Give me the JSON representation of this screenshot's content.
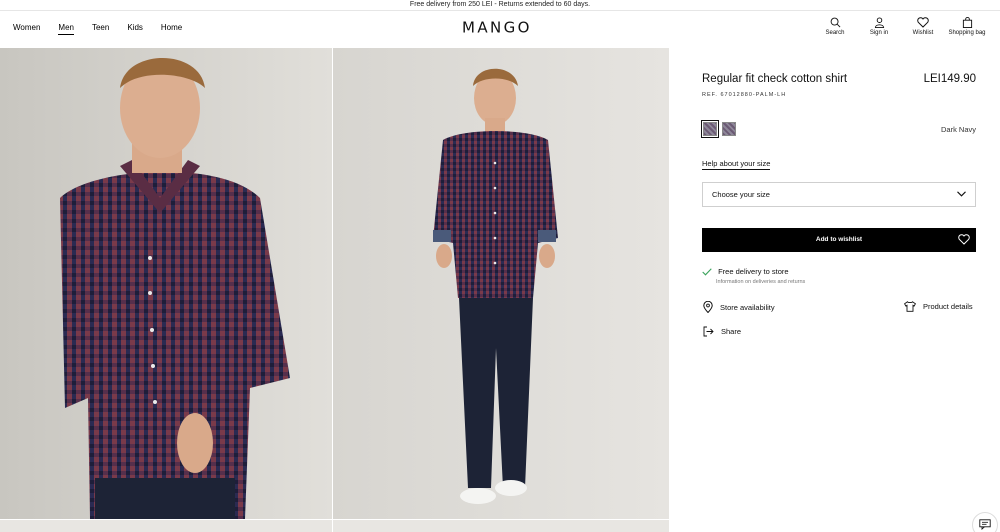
{
  "promo": "Free delivery from 250 LEI - Returns extended to 60 days.",
  "nav": [
    {
      "label": "Women",
      "active": false
    },
    {
      "label": "Men",
      "active": true
    },
    {
      "label": "Teen",
      "active": false
    },
    {
      "label": "Kids",
      "active": false
    },
    {
      "label": "Home",
      "active": false
    }
  ],
  "logo": "MANGO",
  "tools": {
    "search": "Search",
    "signin": "Sign in",
    "wishlist": "Wishlist",
    "bag": "Shopping bag"
  },
  "product": {
    "title": "Regular fit check cotton shirt",
    "price": "LEI149.90",
    "ref": "REF. 67012880-PALM-LH",
    "color_name": "Dark Navy",
    "help_size": "Help about your size",
    "size_placeholder": "Choose your size",
    "wishlist_button": "Add to wishlist",
    "delivery_title": "Free delivery to store",
    "delivery_sub": "Information on deliveries and returns",
    "store_availability": "Store availability",
    "product_details": "Product details",
    "share": "Share"
  }
}
